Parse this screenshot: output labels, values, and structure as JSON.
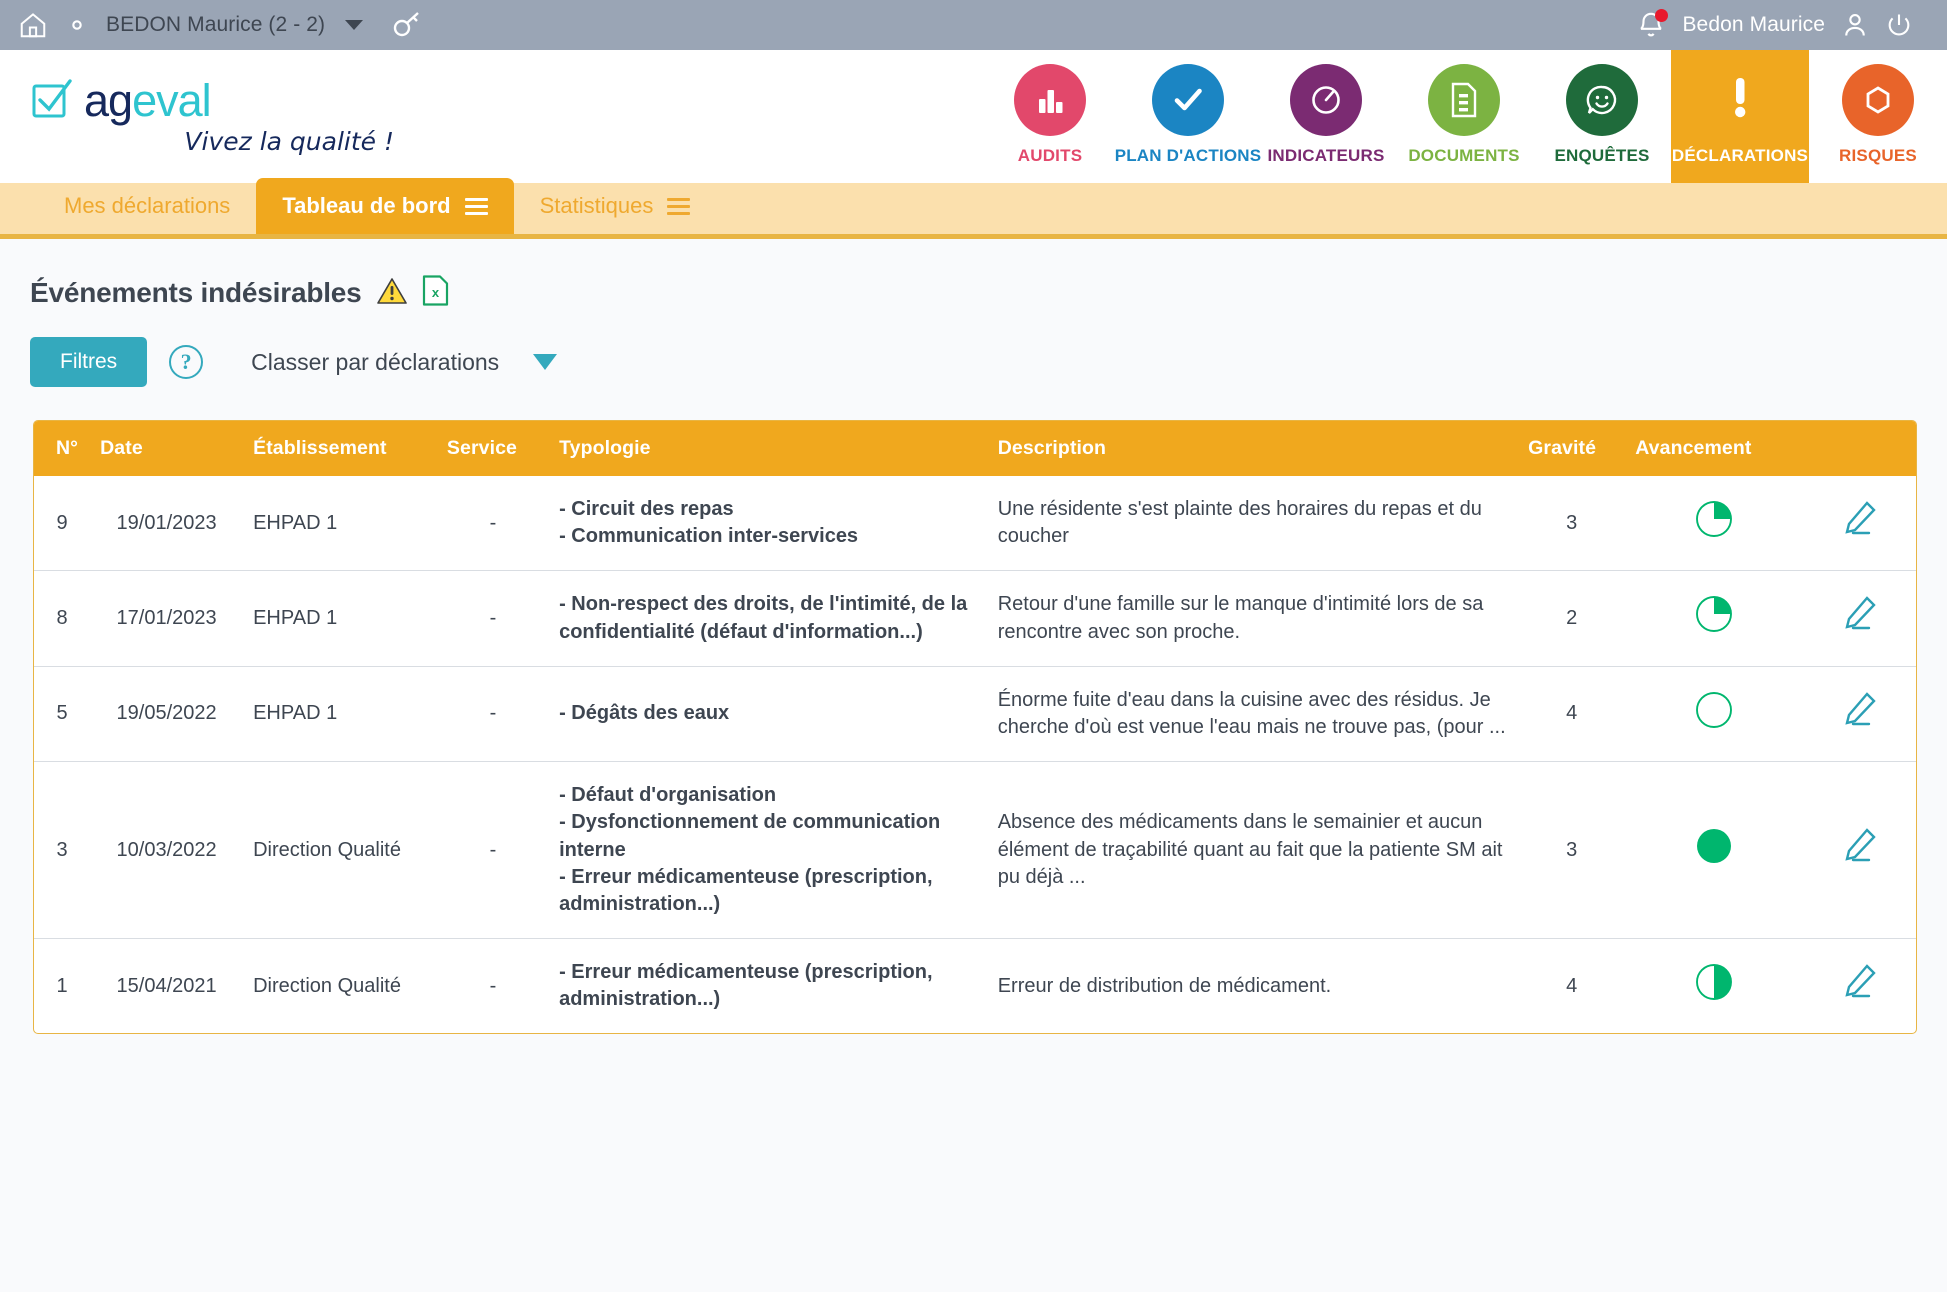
{
  "topbar": {
    "home_icon": "home-icon",
    "settings_icon": "gear-icon",
    "org_selector": "BEDON Maurice (2 - 2)",
    "key_icon": "key-icon",
    "notifications_icon": "bell-icon",
    "user_name": "Bedon Maurice",
    "profile_icon": "user-icon",
    "logout_icon": "power-icon",
    "bg_color": "#9aa5b5"
  },
  "brand": {
    "name_part1": "ag",
    "name_part2": "eval",
    "tagline": "Vivez la qualité !",
    "check_icon": "checkbox-check-icon",
    "dark_color": "#16295c",
    "teal_color": "#2ec4cf"
  },
  "mainnav": {
    "items": [
      {
        "label": "AUDITS",
        "icon": "bar-chart-icon",
        "color": "#e2486b",
        "active": false
      },
      {
        "label": "PLAN D'ACTIONS",
        "icon": "check-circle-icon",
        "color": "#1b85c3",
        "active": false
      },
      {
        "label": "INDICATEURS",
        "icon": "gauge-icon",
        "color": "#7b2b72",
        "active": false
      },
      {
        "label": "DOCUMENTS",
        "icon": "document-icon",
        "color": "#7cb342",
        "active": false
      },
      {
        "label": "ENQUÊTES",
        "icon": "smiley-chat-icon",
        "color": "#1f6b3b",
        "active": false
      },
      {
        "label": "DÉCLARATIONS",
        "icon": "exclamation-icon",
        "color": "#f0a81e",
        "active": true
      },
      {
        "label": "RISQUES",
        "icon": "hexagon-icon",
        "color": "#e8642a",
        "active": false
      }
    ]
  },
  "tabs": [
    {
      "label": "Mes déclarations",
      "active": false,
      "has_menu": false
    },
    {
      "label": "Tableau de bord",
      "active": true,
      "has_menu": true
    },
    {
      "label": "Statistiques",
      "active": false,
      "has_menu": true
    }
  ],
  "header_section": {
    "title": "Événements indésirables",
    "warning_icon": "warning-triangle-icon",
    "export_icon": "excel-export-icon"
  },
  "toolbar": {
    "filters_label": "Filtres",
    "help_icon": "question-mark-icon",
    "help_label": "?",
    "sort_label": "Classer par déclarations",
    "sort_caret_icon": "caret-down-icon",
    "accent_color": "#34a9bd"
  },
  "table": {
    "columns": [
      "N°",
      "Date",
      "Établissement",
      "Service",
      "Typologie",
      "Description",
      "Gravité",
      "Avancement",
      ""
    ],
    "rows": [
      {
        "num": "9",
        "date": "19/01/2023",
        "etablissement": "EHPAD 1",
        "service": "-",
        "typologie": "- Circuit des repas\n- Communication inter-services",
        "description": "Une résidente s'est plainte des horaires du repas et du coucher",
        "gravite": "3",
        "avancement_percent": 25,
        "edit_icon": "pencil-edit-icon"
      },
      {
        "num": "8",
        "date": "17/01/2023",
        "etablissement": "EHPAD 1",
        "service": "-",
        "typologie": "- Non-respect des droits, de l'intimité, de la confidentialité (défaut d'information...)",
        "description": "Retour d'une famille sur le manque d'intimité lors de sa rencontre avec son proche.",
        "gravite": "2",
        "avancement_percent": 25,
        "edit_icon": "pencil-edit-icon"
      },
      {
        "num": "5",
        "date": "19/05/2022",
        "etablissement": "EHPAD 1",
        "service": "-",
        "typologie": "- Dégâts des eaux",
        "description": "Énorme fuite d'eau dans la cuisine avec des résidus. Je cherche d'où est venue l'eau mais ne trouve pas, (pour ...",
        "gravite": "4",
        "avancement_percent": 0,
        "edit_icon": "pencil-edit-icon"
      },
      {
        "num": "3",
        "date": "10/03/2022",
        "etablissement": "Direction Qualité",
        "service": "-",
        "typologie": "- Défaut d'organisation\n- Dysfonctionnement de communication interne\n- Erreur médicamenteuse (prescription, administration...)",
        "description": "Absence des médicaments dans le semainier et aucun élément de traçabilité quant au fait que la patiente SM ait pu déjà ...",
        "gravite": "3",
        "avancement_percent": 100,
        "edit_icon": "pencil-edit-icon"
      },
      {
        "num": "1",
        "date": "15/04/2021",
        "etablissement": "Direction Qualité",
        "service": "-",
        "typologie": "- Erreur médicamenteuse (prescription, administration...)",
        "description": "Erreur de distribution de médicament.",
        "gravite": "4",
        "avancement_percent": 50,
        "edit_icon": "pencil-edit-icon"
      }
    ]
  },
  "colors": {
    "progress_green": "#00b66e",
    "table_header": "#f0a81e",
    "tabbar_bg": "#fbe0ad",
    "page_bg": "#f9fafc",
    "edit_icon": "#2b9fb5"
  }
}
